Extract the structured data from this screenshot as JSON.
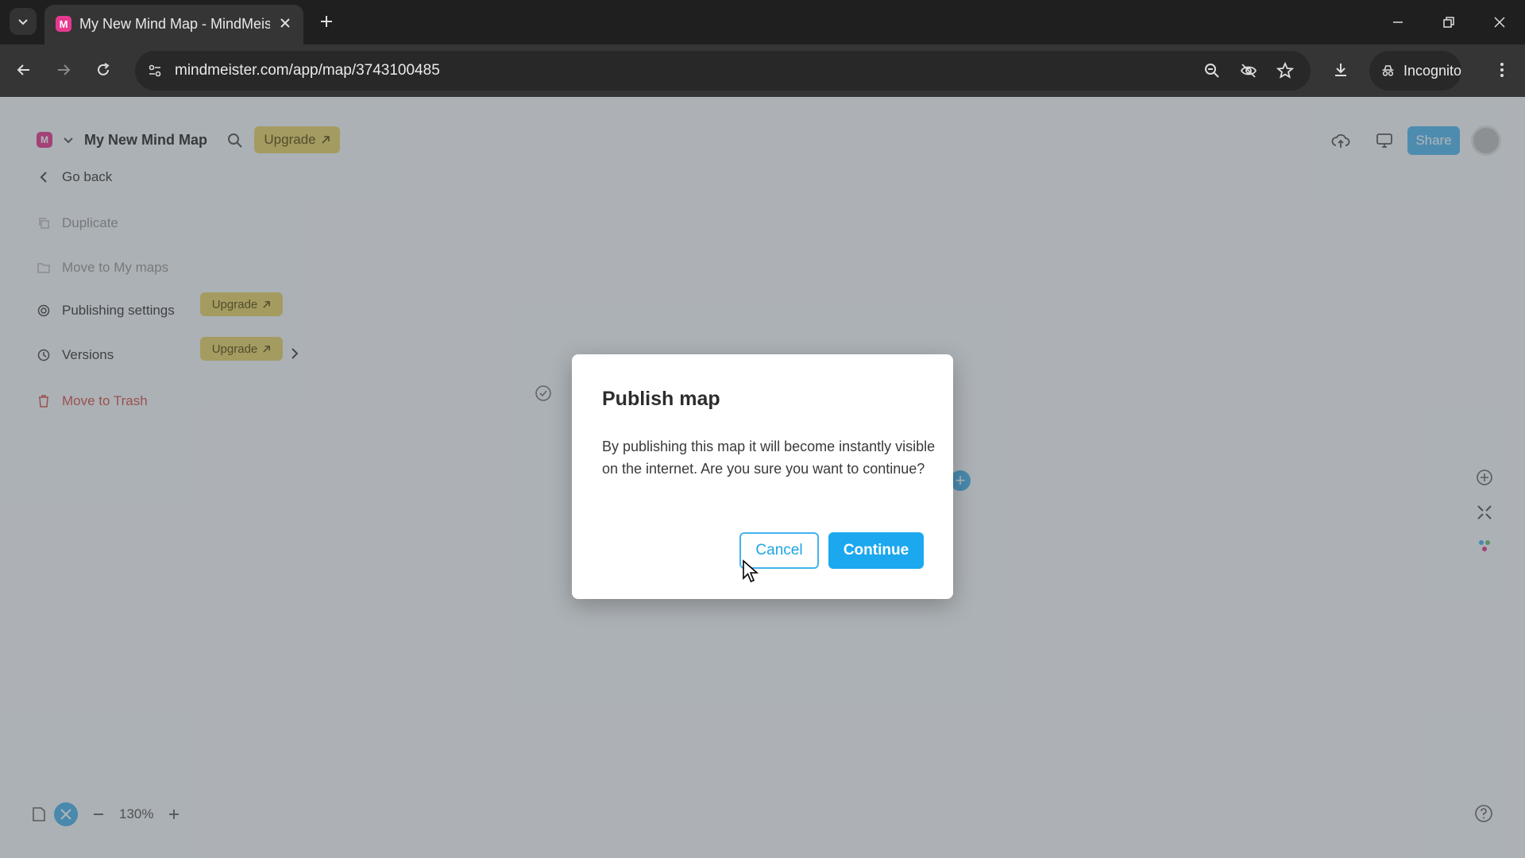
{
  "browser": {
    "tab_title": "My New Mind Map - MindMeis",
    "favicon_letter": "M",
    "url": "mindmeister.com/app/map/3743100485",
    "incognito_label": "Incognito"
  },
  "app": {
    "logo_letter": "M",
    "map_title": "My New Mind Map",
    "upgrade_label": "Upgrade",
    "share_label": "Share",
    "menu": {
      "go_back": "Go back",
      "duplicate": "Duplicate",
      "move_to_my_maps": "Move to My maps",
      "upgrade_chip": "Upgrade",
      "publishing_settings": "Publishing settings",
      "versions": "Versions",
      "move_to_trash": "Move to Trash"
    },
    "zoom_level": "130%"
  },
  "modal": {
    "title": "Publish map",
    "body": "By publishing this map it will become instantly visible on the internet. Are you sure you want to continue?",
    "cancel_label": "Cancel",
    "continue_label": "Continue"
  },
  "colors": {
    "accent": "#1ba8ef",
    "brand": "#e6398f",
    "upgrade": "#e9d36a"
  }
}
